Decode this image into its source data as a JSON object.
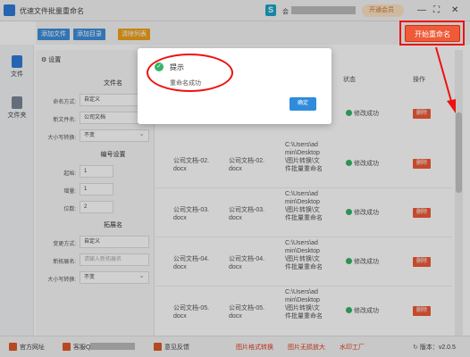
{
  "app": {
    "title": "优速文件批量重命名",
    "user_prefix": "会",
    "vip_label": "开通会员",
    "win_controls": [
      "—",
      "⛶",
      "✕"
    ]
  },
  "toolbar": {
    "add_file": "添加文件",
    "add_dir": "添加目录",
    "clear_list": "清除列表",
    "start_rename": "开始重命名"
  },
  "nav": {
    "file": "文件",
    "folder": "文件夹"
  },
  "settings": {
    "header": "设置",
    "filename_section": "文件名",
    "rename_mode_label": "命名方式:",
    "rename_mode_value": "自定义",
    "new_name_label": "新文件名:",
    "new_name_value": "公司文档",
    "case_label": "大小写转换:",
    "case_value": "不变",
    "numbering_section": "编号设置",
    "start_label": "起始:",
    "start_value": "1",
    "step_label": "增量:",
    "step_value": "1",
    "digits_label": "位数:",
    "digits_value": "2",
    "ext_section": "拓展名",
    "ext_mode_label": "变更方式:",
    "ext_mode_value": "自定义",
    "new_ext_label": "新拓展名:",
    "new_ext_placeholder": "请输入新拓展名",
    "ext_case_label": "大小写转换:",
    "ext_case_value": "不变"
  },
  "table": {
    "col_status": "状态",
    "col_action": "操作",
    "rows": [
      {
        "name": "公司文档-02.\ndocx",
        "new_name": "公司文档-02.\ndocx",
        "path": "C:\\Users\\ad\nmin\\Desktop\n\\图片转换\\文\n件批量重命名",
        "status": "修改成功",
        "action": "删除"
      },
      {
        "name": "公司文档-03.\ndocx",
        "new_name": "公司文档-03.\ndocx",
        "path": "C:\\Users\\ad\nmin\\Desktop\n\\图片转换\\文\n件批量重命名",
        "status": "修改成功",
        "action": "删除"
      },
      {
        "name": "公司文档-04.\ndocx",
        "new_name": "公司文档-04.\ndocx",
        "path": "C:\\Users\\ad\nmin\\Desktop\n\\图片转换\\文\n件批量重命名",
        "status": "修改成功",
        "action": "删除"
      },
      {
        "name": "公司文档-05.\ndocx",
        "new_name": "公司文档-05.\ndocx",
        "path": "C:\\Users\\ad\nmin\\Desktop\n\\图片转换\\文\n件批量重命名",
        "status": "修改成功",
        "action": "删除"
      }
    ],
    "first_row_status": "修改成功",
    "first_row_action": "删除"
  },
  "bottom": {
    "website": "官方网址",
    "qq_prefix": "客服Q",
    "feedback": "意见反馈",
    "img_convert": "图片格式转换",
    "img_enlarge": "图片无损放大",
    "watermark": "水印工厂",
    "version": "版本：v2.0.5"
  },
  "modal": {
    "title": "提示",
    "message": "重命名成功",
    "ok": "确定"
  },
  "colors": {
    "accent_orange": "#ef5a38",
    "success_green": "#36b368",
    "primary_blue": "#2f8cdb",
    "annotation_red": "#e11111"
  }
}
